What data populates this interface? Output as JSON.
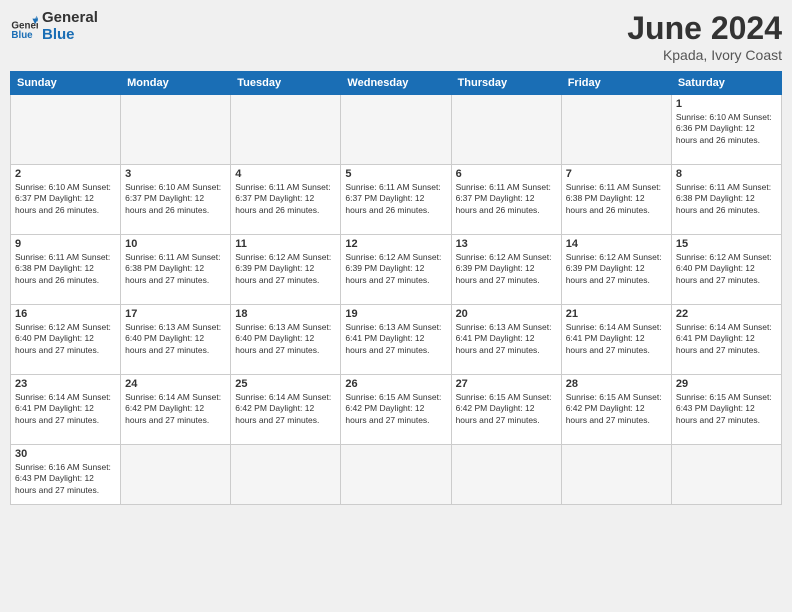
{
  "logo": {
    "general": "General",
    "blue": "Blue"
  },
  "title": "June 2024",
  "subtitle": "Kpada, Ivory Coast",
  "days_header": [
    "Sunday",
    "Monday",
    "Tuesday",
    "Wednesday",
    "Thursday",
    "Friday",
    "Saturday"
  ],
  "weeks": [
    [
      {
        "num": "",
        "info": ""
      },
      {
        "num": "",
        "info": ""
      },
      {
        "num": "",
        "info": ""
      },
      {
        "num": "",
        "info": ""
      },
      {
        "num": "",
        "info": ""
      },
      {
        "num": "",
        "info": ""
      },
      {
        "num": "1",
        "info": "Sunrise: 6:10 AM\nSunset: 6:36 PM\nDaylight: 12 hours and 26 minutes."
      }
    ],
    [
      {
        "num": "2",
        "info": "Sunrise: 6:10 AM\nSunset: 6:37 PM\nDaylight: 12 hours and 26 minutes."
      },
      {
        "num": "3",
        "info": "Sunrise: 6:10 AM\nSunset: 6:37 PM\nDaylight: 12 hours and 26 minutes."
      },
      {
        "num": "4",
        "info": "Sunrise: 6:11 AM\nSunset: 6:37 PM\nDaylight: 12 hours and 26 minutes."
      },
      {
        "num": "5",
        "info": "Sunrise: 6:11 AM\nSunset: 6:37 PM\nDaylight: 12 hours and 26 minutes."
      },
      {
        "num": "6",
        "info": "Sunrise: 6:11 AM\nSunset: 6:37 PM\nDaylight: 12 hours and 26 minutes."
      },
      {
        "num": "7",
        "info": "Sunrise: 6:11 AM\nSunset: 6:38 PM\nDaylight: 12 hours and 26 minutes."
      },
      {
        "num": "8",
        "info": "Sunrise: 6:11 AM\nSunset: 6:38 PM\nDaylight: 12 hours and 26 minutes."
      }
    ],
    [
      {
        "num": "9",
        "info": "Sunrise: 6:11 AM\nSunset: 6:38 PM\nDaylight: 12 hours and 26 minutes."
      },
      {
        "num": "10",
        "info": "Sunrise: 6:11 AM\nSunset: 6:38 PM\nDaylight: 12 hours and 27 minutes."
      },
      {
        "num": "11",
        "info": "Sunrise: 6:12 AM\nSunset: 6:39 PM\nDaylight: 12 hours and 27 minutes."
      },
      {
        "num": "12",
        "info": "Sunrise: 6:12 AM\nSunset: 6:39 PM\nDaylight: 12 hours and 27 minutes."
      },
      {
        "num": "13",
        "info": "Sunrise: 6:12 AM\nSunset: 6:39 PM\nDaylight: 12 hours and 27 minutes."
      },
      {
        "num": "14",
        "info": "Sunrise: 6:12 AM\nSunset: 6:39 PM\nDaylight: 12 hours and 27 minutes."
      },
      {
        "num": "15",
        "info": "Sunrise: 6:12 AM\nSunset: 6:40 PM\nDaylight: 12 hours and 27 minutes."
      }
    ],
    [
      {
        "num": "16",
        "info": "Sunrise: 6:12 AM\nSunset: 6:40 PM\nDaylight: 12 hours and 27 minutes."
      },
      {
        "num": "17",
        "info": "Sunrise: 6:13 AM\nSunset: 6:40 PM\nDaylight: 12 hours and 27 minutes."
      },
      {
        "num": "18",
        "info": "Sunrise: 6:13 AM\nSunset: 6:40 PM\nDaylight: 12 hours and 27 minutes."
      },
      {
        "num": "19",
        "info": "Sunrise: 6:13 AM\nSunset: 6:41 PM\nDaylight: 12 hours and 27 minutes."
      },
      {
        "num": "20",
        "info": "Sunrise: 6:13 AM\nSunset: 6:41 PM\nDaylight: 12 hours and 27 minutes."
      },
      {
        "num": "21",
        "info": "Sunrise: 6:14 AM\nSunset: 6:41 PM\nDaylight: 12 hours and 27 minutes."
      },
      {
        "num": "22",
        "info": "Sunrise: 6:14 AM\nSunset: 6:41 PM\nDaylight: 12 hours and 27 minutes."
      }
    ],
    [
      {
        "num": "23",
        "info": "Sunrise: 6:14 AM\nSunset: 6:41 PM\nDaylight: 12 hours and 27 minutes."
      },
      {
        "num": "24",
        "info": "Sunrise: 6:14 AM\nSunset: 6:42 PM\nDaylight: 12 hours and 27 minutes."
      },
      {
        "num": "25",
        "info": "Sunrise: 6:14 AM\nSunset: 6:42 PM\nDaylight: 12 hours and 27 minutes."
      },
      {
        "num": "26",
        "info": "Sunrise: 6:15 AM\nSunset: 6:42 PM\nDaylight: 12 hours and 27 minutes."
      },
      {
        "num": "27",
        "info": "Sunrise: 6:15 AM\nSunset: 6:42 PM\nDaylight: 12 hours and 27 minutes."
      },
      {
        "num": "28",
        "info": "Sunrise: 6:15 AM\nSunset: 6:42 PM\nDaylight: 12 hours and 27 minutes."
      },
      {
        "num": "29",
        "info": "Sunrise: 6:15 AM\nSunset: 6:43 PM\nDaylight: 12 hours and 27 minutes."
      }
    ],
    [
      {
        "num": "30",
        "info": "Sunrise: 6:16 AM\nSunset: 6:43 PM\nDaylight: 12 hours and 27 minutes."
      },
      {
        "num": "",
        "info": ""
      },
      {
        "num": "",
        "info": ""
      },
      {
        "num": "",
        "info": ""
      },
      {
        "num": "",
        "info": ""
      },
      {
        "num": "",
        "info": ""
      },
      {
        "num": "",
        "info": ""
      }
    ]
  ]
}
